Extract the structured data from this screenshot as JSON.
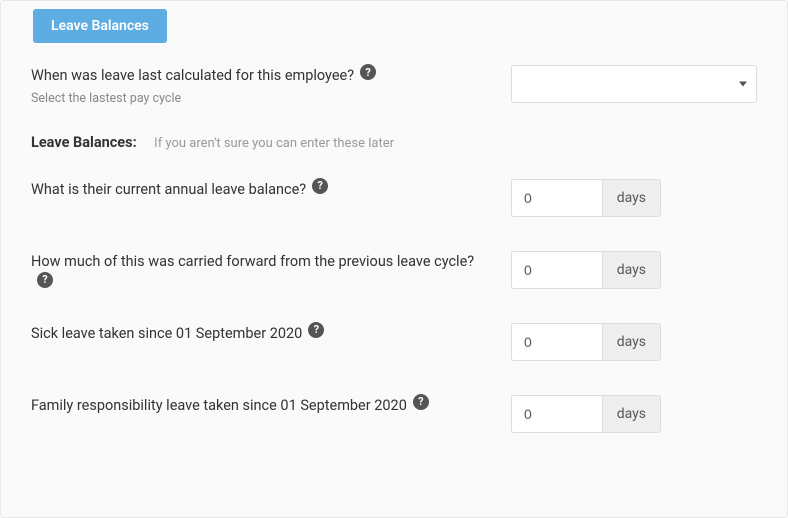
{
  "tab": {
    "label": "Leave Balances"
  },
  "fields": {
    "lastCalculated": {
      "label": "When was leave last calculated for this employee?",
      "sub": "Select the lastest pay cycle",
      "value": ""
    },
    "section": {
      "title": "Leave Balances:",
      "hint": "If you aren't sure you can enter these later"
    },
    "annualBalance": {
      "label": "What is their current annual leave balance?",
      "value": "0",
      "unit": "days"
    },
    "carriedForward": {
      "label": "How much of this was carried forward from the previous leave cycle?",
      "value": "0",
      "unit": "days"
    },
    "sickLeave": {
      "label": "Sick leave taken since 01 September 2020",
      "value": "0",
      "unit": "days"
    },
    "familyLeave": {
      "label": "Family responsibility leave taken since 01 September 2020",
      "value": "0",
      "unit": "days"
    }
  }
}
